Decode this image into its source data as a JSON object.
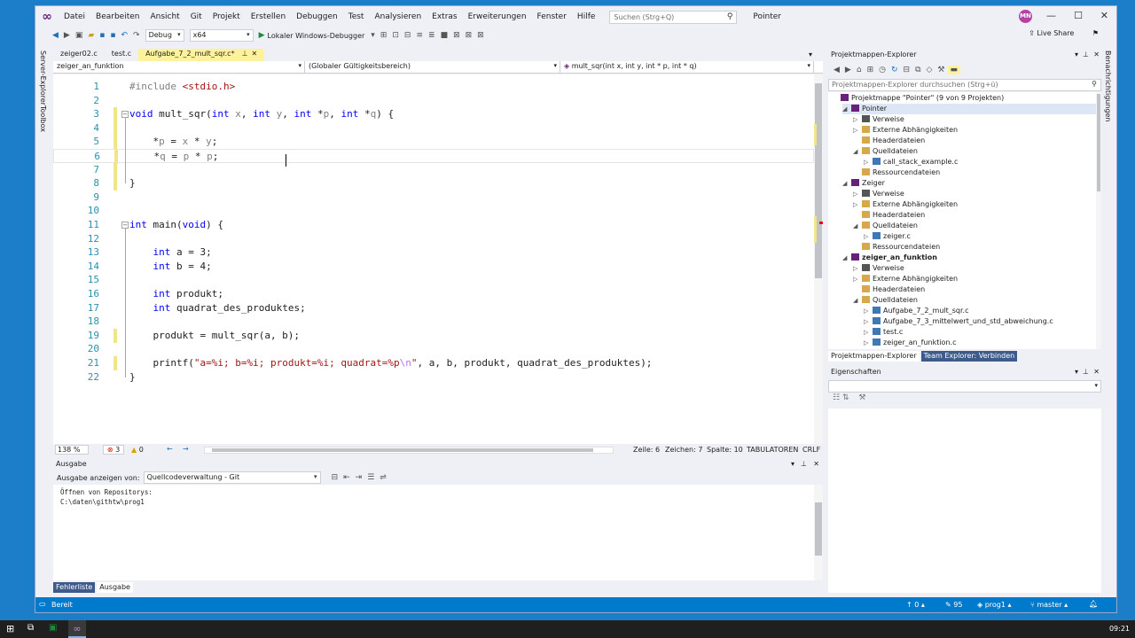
{
  "menu": {
    "items": [
      "Datei",
      "Bearbeiten",
      "Ansicht",
      "Git",
      "Projekt",
      "Erstellen",
      "Debuggen",
      "Test",
      "Analysieren",
      "Extras",
      "Erweiterungen",
      "Fenster",
      "Hilfe"
    ],
    "search_placeholder": "Suchen (Strg+Q)",
    "solution_name": "Pointer",
    "avatar_initials": "MN"
  },
  "toolbar": {
    "config": "Debug",
    "platform": "x64",
    "run_label": "Lokaler Windows-Debugger",
    "live_share": "Live Share"
  },
  "sidebar": {
    "left_tabs": [
      "Server-Explorer",
      "Toolbox"
    ],
    "right_tabs": [
      "Benachrichtigungen"
    ]
  },
  "editor": {
    "tabs": [
      {
        "label": "zeiger02.c",
        "active": false
      },
      {
        "label": "test.c",
        "active": false
      },
      {
        "label": "Aufgabe_7_2_mult_sqr.c*",
        "active": true
      }
    ],
    "nav": {
      "project": "zeiger_an_funktion",
      "scope": "(Globaler Gültigkeitsbereich)",
      "member": "mult_sqr(int x, int y, int * p, int * q)"
    },
    "status": {
      "zoom": "138 %",
      "errors": "3",
      "warnings": "0",
      "line": "Zeile: 6",
      "char": "Zeichen: 7",
      "col": "Spalte: 10",
      "tabs": "TABULATOREN",
      "eol": "CRLF"
    }
  },
  "code": {
    "lines": [
      {
        "n": "1",
        "html": "<span class=\"pp\">#include</span> <span class=\"str\">&lt;stdio.h&gt;</span>"
      },
      {
        "n": "2",
        "html": ""
      },
      {
        "n": "3",
        "html": "<span class=\"kw\">void</span> mult_sqr(<span class=\"kw\">int</span> <span class=\"pm\">x</span>, <span class=\"kw\">int</span> <span class=\"pm\">y</span>, <span class=\"kw\">int</span> *<span class=\"pm\">p</span>, <span class=\"kw\">int</span> *<span class=\"pm\">q</span>) {"
      },
      {
        "n": "4",
        "html": ""
      },
      {
        "n": "5",
        "html": "    *<span class=\"pm\">p</span> = <span class=\"pm\">x</span> * <span class=\"pm\">y</span>;"
      },
      {
        "n": "6",
        "html": "    *<span class=\"pm\">q</span> = <span class=\"pm\">p</span> * <span class=\"pm\">p</span>;"
      },
      {
        "n": "7",
        "html": ""
      },
      {
        "n": "8",
        "html": "}"
      },
      {
        "n": "9",
        "html": ""
      },
      {
        "n": "10",
        "html": ""
      },
      {
        "n": "11",
        "html": "<span class=\"kw\">int</span> main(<span class=\"kw\">void</span>) {"
      },
      {
        "n": "12",
        "html": ""
      },
      {
        "n": "13",
        "html": "    <span class=\"kw\">int</span> a = 3;"
      },
      {
        "n": "14",
        "html": "    <span class=\"kw\">int</span> b = 4;"
      },
      {
        "n": "15",
        "html": ""
      },
      {
        "n": "16",
        "html": "    <span class=\"kw\">int</span> produkt;"
      },
      {
        "n": "17",
        "html": "    <span class=\"kw\">int</span> quadrat_des_produktes;"
      },
      {
        "n": "18",
        "html": ""
      },
      {
        "n": "19",
        "html": "    produkt = mult_sqr(a, b);"
      },
      {
        "n": "20",
        "html": ""
      },
      {
        "n": "21",
        "html": "    printf(<span class=\"str\">\"a=%i; b=%i; produkt=%i; quadrat=%p<span class=\"esc\">\\n</span>\"</span>, a, b, produkt, quadrat_des_produktes);"
      },
      {
        "n": "22",
        "html": "}"
      }
    ]
  },
  "output": {
    "title": "Ausgabe",
    "show_from_label": "Ausgabe anzeigen von:",
    "source": "Quellcodeverwaltung - Git",
    "lines": [
      "Öffnen von Repositorys:",
      "C:\\daten\\githtw\\prog1"
    ],
    "tabs": [
      {
        "label": "Fehlerliste",
        "active": false
      },
      {
        "label": "Ausgabe",
        "active": true
      }
    ]
  },
  "solution_explorer": {
    "title": "Projektmappen-Explorer",
    "search_placeholder": "Projektmappen-Explorer durchsuchen (Strg+ü)",
    "tree": [
      {
        "label": "Projektmappe \"Pointer\" (9 von 9 Projekten)",
        "level": 0,
        "arrow": "",
        "color": "#68217a"
      },
      {
        "label": "Pointer",
        "level": 1,
        "arrow": "◢",
        "color": "#68217a",
        "selected": true
      },
      {
        "label": "Verweise",
        "level": 2,
        "arrow": "▷",
        "color": "#555555"
      },
      {
        "label": "Externe Abhängigkeiten",
        "level": 2,
        "arrow": "▷",
        "color": "#d6a84a"
      },
      {
        "label": "Headerdateien",
        "level": 2,
        "arrow": "",
        "color": "#d6a84a"
      },
      {
        "label": "Quelldateien",
        "level": 2,
        "arrow": "◢",
        "color": "#d6a84a"
      },
      {
        "label": "call_stack_example.c",
        "level": 3,
        "arrow": "▷",
        "color": "#3e79b6"
      },
      {
        "label": "Ressourcendateien",
        "level": 2,
        "arrow": "",
        "color": "#d6a84a"
      },
      {
        "label": "Zeiger",
        "level": 1,
        "arrow": "◢",
        "color": "#68217a"
      },
      {
        "label": "Verweise",
        "level": 2,
        "arrow": "▷",
        "color": "#555555"
      },
      {
        "label": "Externe Abhängigkeiten",
        "level": 2,
        "arrow": "▷",
        "color": "#d6a84a"
      },
      {
        "label": "Headerdateien",
        "level": 2,
        "arrow": "",
        "color": "#d6a84a"
      },
      {
        "label": "Quelldateien",
        "level": 2,
        "arrow": "◢",
        "color": "#d6a84a"
      },
      {
        "label": "zeiger.c",
        "level": 3,
        "arrow": "▷",
        "color": "#3e79b6"
      },
      {
        "label": "Ressourcendateien",
        "level": 2,
        "arrow": "",
        "color": "#d6a84a"
      },
      {
        "label": "zeiger_an_funktion",
        "level": 1,
        "arrow": "◢",
        "color": "#68217a",
        "bold": true
      },
      {
        "label": "Verweise",
        "level": 2,
        "arrow": "▷",
        "color": "#555555"
      },
      {
        "label": "Externe Abhängigkeiten",
        "level": 2,
        "arrow": "▷",
        "color": "#d6a84a"
      },
      {
        "label": "Headerdateien",
        "level": 2,
        "arrow": "",
        "color": "#d6a84a"
      },
      {
        "label": "Quelldateien",
        "level": 2,
        "arrow": "◢",
        "color": "#d6a84a"
      },
      {
        "label": "Aufgabe_7_2_mult_sqr.c",
        "level": 3,
        "arrow": "▷",
        "color": "#3e79b6"
      },
      {
        "label": "Aufgabe_7_3_mittelwert_und_std_abweichung.c",
        "level": 3,
        "arrow": "▷",
        "color": "#3e79b6"
      },
      {
        "label": "test.c",
        "level": 3,
        "arrow": "▷",
        "color": "#3e79b6"
      },
      {
        "label": "zeiger_an_funktion.c",
        "level": 3,
        "arrow": "▷",
        "color": "#3e79b6"
      }
    ],
    "tabs": [
      {
        "label": "Projektmappen-Explorer",
        "active": true
      },
      {
        "label": "Team Explorer: Verbinden",
        "active": false
      }
    ]
  },
  "properties": {
    "title": "Eigenschaften"
  },
  "statusbar": {
    "ready": "Bereit",
    "up_count": "0",
    "edit_count": "95",
    "repo": "prog1",
    "branch": "master"
  },
  "taskbar": {
    "time": "09:21"
  }
}
